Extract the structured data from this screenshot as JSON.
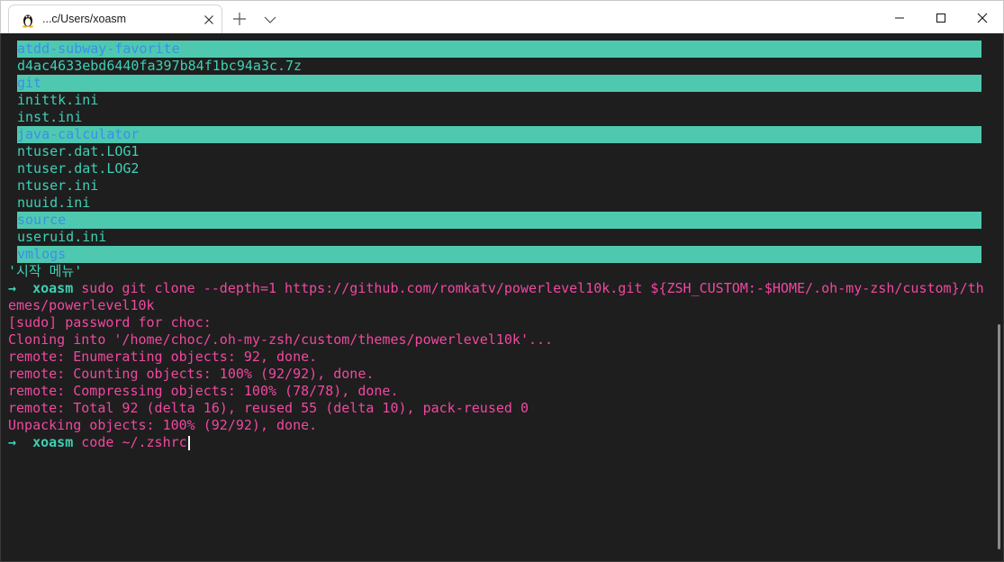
{
  "window": {
    "tab_title": "...c/Users/xoasm",
    "icon": "linux-penguin-icon"
  },
  "listing": [
    {
      "name": "atdd-subway-favorite",
      "type": "dir"
    },
    {
      "name": "d4ac4633ebd6440fa397b84f1bc94a3c.7z",
      "type": "file"
    },
    {
      "name": "git",
      "type": "dir"
    },
    {
      "name": "inittk.ini",
      "type": "file"
    },
    {
      "name": "inst.ini",
      "type": "file"
    },
    {
      "name": "java-calculator",
      "type": "dir"
    },
    {
      "name": "ntuser.dat.LOG1",
      "type": "file"
    },
    {
      "name": "ntuser.dat.LOG2",
      "type": "file"
    },
    {
      "name": "ntuser.ini",
      "type": "file"
    },
    {
      "name": "nuuid.ini",
      "type": "file"
    },
    {
      "name": "source",
      "type": "dir"
    },
    {
      "name": "useruid.ini",
      "type": "file"
    },
    {
      "name": "vmlogs",
      "type": "dir"
    }
  ],
  "korean_entry": "'시작 메뉴'",
  "prompt": {
    "arrow": "→",
    "user": "xoasm"
  },
  "commands": {
    "clone_line1": "sudo git clone --depth=1 https://github.com/romkatv/powerlevel10k.git ${ZSH_CUSTOM:-$HOME/.oh-my-zsh/custom}/th",
    "clone_line2": "emes/powerlevel10k",
    "current": "code ~/.zshrc"
  },
  "output": [
    "[sudo] password for choc:",
    "Cloning into '/home/choc/.oh-my-zsh/custom/themes/powerlevel10k'...",
    "remote: Enumerating objects: 92, done.",
    "remote: Counting objects: 100% (92/92), done.",
    "remote: Compressing objects: 100% (78/78), done.",
    "remote: Total 92 (delta 16), reused 55 (delta 10), pack-reused 0",
    "Unpacking objects: 100% (92/92), done."
  ],
  "colors": {
    "background": "#1e1e1e",
    "dir_highlight": "#4ec9b0",
    "dir_text": "#3b8eea",
    "file_text": "#3fd0b4",
    "output_text": "#f048a0"
  }
}
